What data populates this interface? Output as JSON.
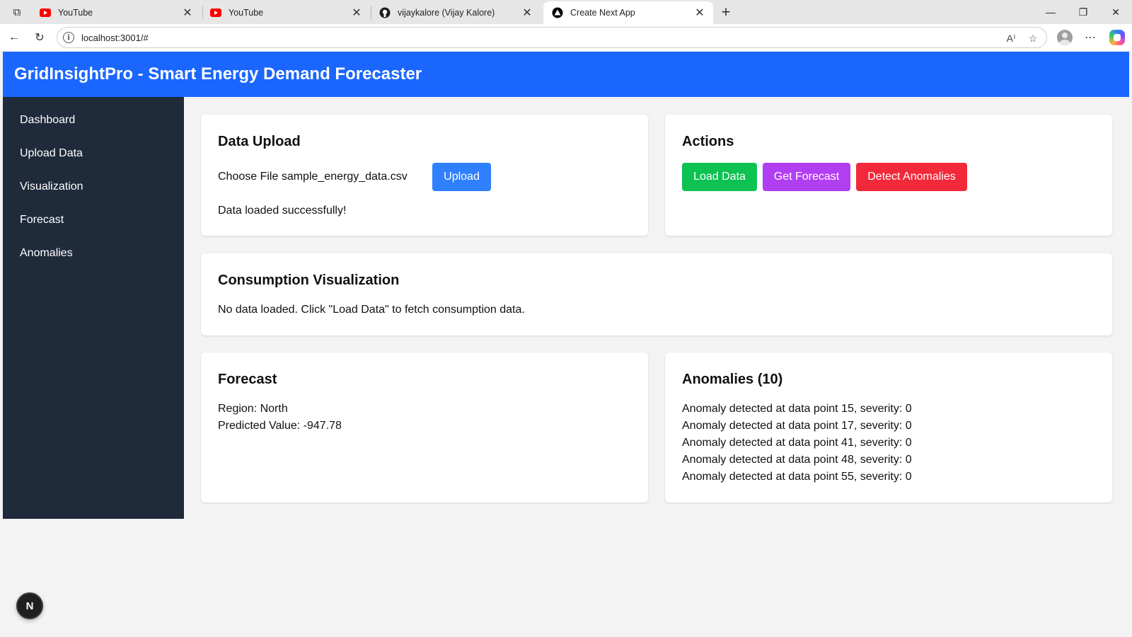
{
  "browser": {
    "tabs": [
      {
        "title": "YouTube",
        "icon": "youtube-icon",
        "active": false
      },
      {
        "title": "YouTube",
        "icon": "youtube-icon",
        "active": false
      },
      {
        "title": "vijaykalore (Vijay Kalore)",
        "icon": "github-icon",
        "active": false
      },
      {
        "title": "Create Next App",
        "icon": "nextjs-icon",
        "active": true
      }
    ],
    "url": "localhost:3001/#"
  },
  "app": {
    "title": "GridInsightPro - Smart Energy Demand Forecaster",
    "header_color": "#1a66ff",
    "sidebar_color": "#1f2a3b"
  },
  "sidebar": {
    "items": [
      {
        "label": "Dashboard"
      },
      {
        "label": "Upload Data"
      },
      {
        "label": "Visualization"
      },
      {
        "label": "Forecast"
      },
      {
        "label": "Anomalies"
      }
    ]
  },
  "upload": {
    "heading": "Data Upload",
    "choose_file": "Choose File",
    "file_name": "sample_energy_data.csv",
    "upload_label": "Upload",
    "status": "Data loaded successfully!"
  },
  "actions": {
    "heading": "Actions",
    "load_label": "Load Data",
    "forecast_label": "Get Forecast",
    "anomalies_label": "Detect Anomalies",
    "colors": {
      "load": "#0dc251",
      "forecast": "#b23ef2",
      "anomalies": "#f2293a",
      "upload": "#2f80ff"
    }
  },
  "visualization": {
    "heading": "Consumption Visualization",
    "message": "No data loaded. Click \"Load Data\" to fetch consumption data."
  },
  "forecast": {
    "heading": "Forecast",
    "region": "Region: North",
    "predicted": "Predicted Value: -947.78"
  },
  "anomalies": {
    "heading": "Anomalies (10)",
    "items": [
      "Anomaly detected at data point 15, severity: 0",
      "Anomaly detected at data point 17, severity: 0",
      "Anomaly detected at data point 41, severity: 0",
      "Anomaly detected at data point 48, severity: 0",
      "Anomaly detected at data point 55, severity: 0"
    ]
  },
  "dev_badge": {
    "label": "N"
  }
}
